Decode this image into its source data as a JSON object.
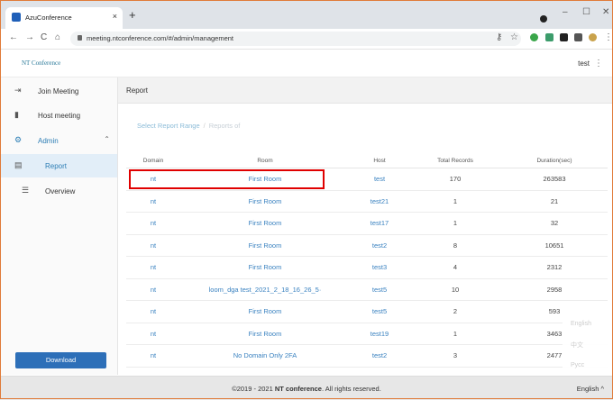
{
  "browser": {
    "tab_title": "AzuConference",
    "tab_close": "×",
    "new_tab": "+",
    "url": "meeting.ntconference.com/#/admin/management",
    "window_minimize": "–",
    "window_restore": "☐",
    "window_close": "✕"
  },
  "app": {
    "brand": "NT Conference",
    "user": "test",
    "kebab": "⋮"
  },
  "sidebar": {
    "items": [
      {
        "label": "Join Meeting",
        "icon": "login-icon"
      },
      {
        "label": "Host meeting",
        "icon": "phone-icon"
      },
      {
        "label": "Admin",
        "icon": "admin-icon",
        "chevron": "⌃"
      },
      {
        "label": "Report",
        "icon": "report-icon",
        "active": true
      },
      {
        "label": "Overview",
        "icon": "list-icon"
      }
    ],
    "download_label": "Download"
  },
  "main": {
    "title": "Report",
    "breadcrumb": {
      "first": "Select Report Range",
      "separator": "/",
      "second": "Reports of"
    },
    "table": {
      "columns": [
        "Domain",
        "Room",
        "Host",
        "Total Records",
        "Duration(sec)"
      ],
      "rows": [
        [
          "nt",
          "First Room",
          "test",
          "170",
          "263583"
        ],
        [
          "nt",
          "First Room",
          "test21",
          "1",
          "21"
        ],
        [
          "nt",
          "First Room",
          "test17",
          "1",
          "32"
        ],
        [
          "nt",
          "First Room",
          "test2",
          "8",
          "10651"
        ],
        [
          "nt",
          "First Room",
          "test3",
          "4",
          "2312"
        ],
        [
          "nt",
          "loom_dga test_2021_2_18_16_26_5·",
          "test5",
          "10",
          "2958"
        ],
        [
          "nt",
          "First Room",
          "test5",
          "2",
          "593"
        ],
        [
          "nt",
          "First Room",
          "test19",
          "1",
          "3463"
        ],
        [
          "nt",
          "No Domain Only 2FA",
          "test2",
          "3",
          "2477"
        ]
      ]
    },
    "language_menu": [
      "English",
      "中文",
      "Русс"
    ]
  },
  "footer": {
    "copyright_prefix": "©2019 - 2021",
    "brand": "NT conference",
    "copyright_suffix": ". All rights reserved.",
    "language": "English ^"
  },
  "colors": {
    "accent": "#2d7eb5",
    "highlight": "#e00000",
    "download_button": "#2d6fb8"
  }
}
